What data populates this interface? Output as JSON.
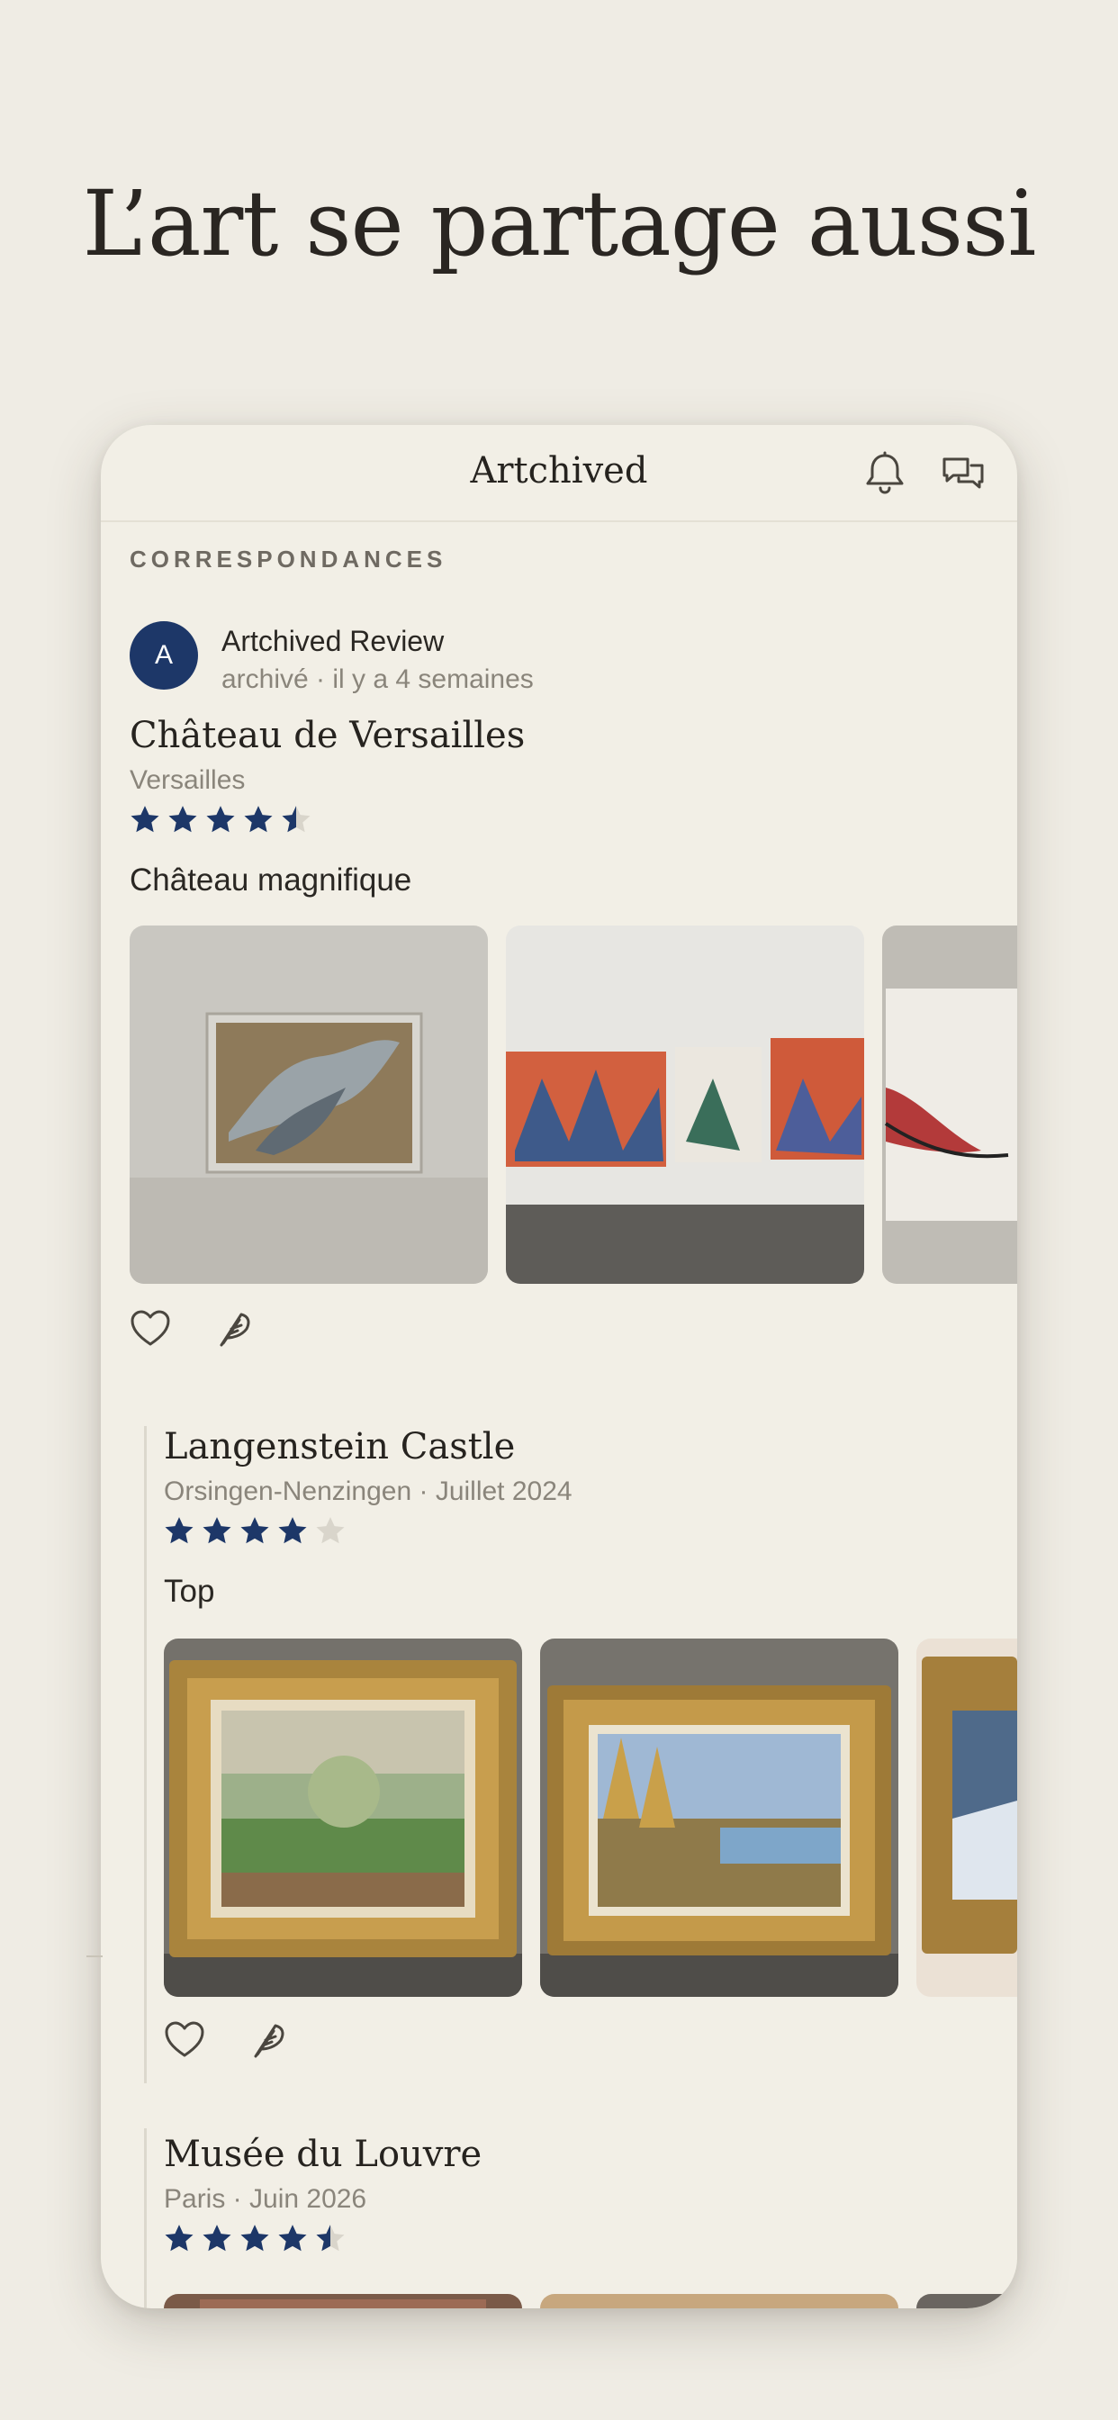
{
  "hero": {
    "headline": "L’art se partage aussi"
  },
  "app": {
    "title": "Artchived",
    "icons": [
      "bell-icon",
      "chat-bubbles-icon"
    ]
  },
  "section": {
    "label": "CORRESPONDANCES"
  },
  "accent_color": "#1d3768",
  "background_color": "#efece4",
  "posts": [
    {
      "avatar_initial": "A",
      "author": "Artchived Review",
      "meta": "archivé · il y a 4 semaines",
      "place": "Château de Versailles",
      "location": "Versailles",
      "rating": 4.5,
      "review": "Château magnifique"
    },
    {
      "place": "Langenstein Castle",
      "location": "Orsingen-Nenzingen · Juillet 2024",
      "rating": 4,
      "review": "Top"
    },
    {
      "place": "Musée du Louvre",
      "location": "Paris · Juin 2026",
      "rating": 4.5
    }
  ]
}
